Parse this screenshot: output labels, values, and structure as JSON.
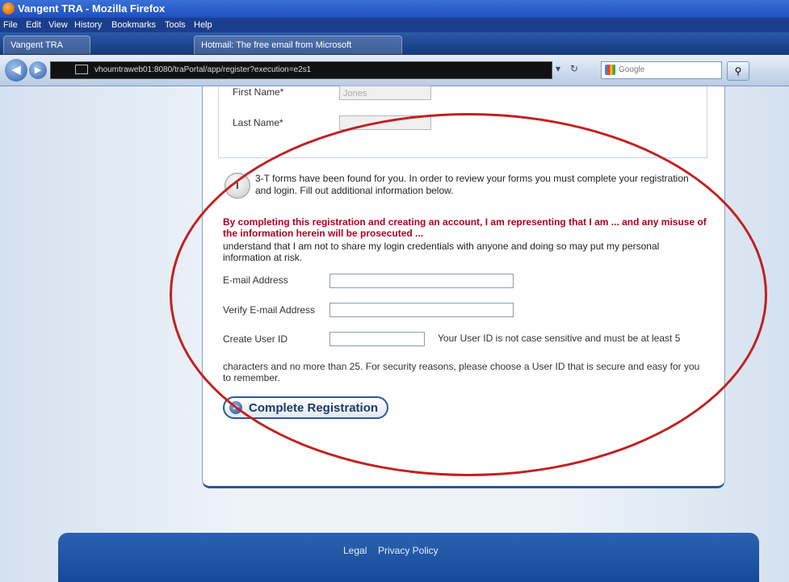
{
  "window": {
    "title": "Vangent TRA - Mozilla Firefox"
  },
  "menu": {
    "items": [
      "File",
      "Edit",
      "View",
      "History",
      "Bookmarks",
      "Tools",
      "Help"
    ]
  },
  "tabs": [
    {
      "label": "Vangent TRA"
    },
    {
      "label": "Hotmail: The free email from Microsoft"
    }
  ],
  "nav": {
    "url": "vhoumtraweb01:8080/traPortal/app/register?execution=e2s1",
    "search_placeholder": "Google"
  },
  "form": {
    "first_name_label": "First Name*",
    "first_name_value": "Jones",
    "last_name_label": "Last Name*",
    "last_name_value": "",
    "info_message": "3-T forms have been found for you. In order to review your forms you must complete your registration and login. Fill out additional information below.",
    "disclaimer_red": "By completing this registration and creating an account, I am representing that I am ... and any misuse of the information herein will be prosecuted ...",
    "disclaimer_plain": "understand that I am not to share my login credentials with anyone and doing so may put my personal information at risk.",
    "email_label": "E-mail Address",
    "verify_email_label": "Verify E-mail Address",
    "user_id_label": "Create User ID",
    "user_id_hint_inline": "Your User ID is not case sensitive and must be at least 5",
    "user_id_hint_block": "characters and no more than 25. For security reasons, please choose a User ID that is secure and easy for you to remember.",
    "complete_button": "Complete Registration"
  },
  "footer": {
    "legal": "Legal",
    "privacy": "Privacy Policy"
  },
  "colors": {
    "annotation": "#c22020",
    "brand_blue": "#2b5aa0",
    "warning_red": "#b00020"
  }
}
